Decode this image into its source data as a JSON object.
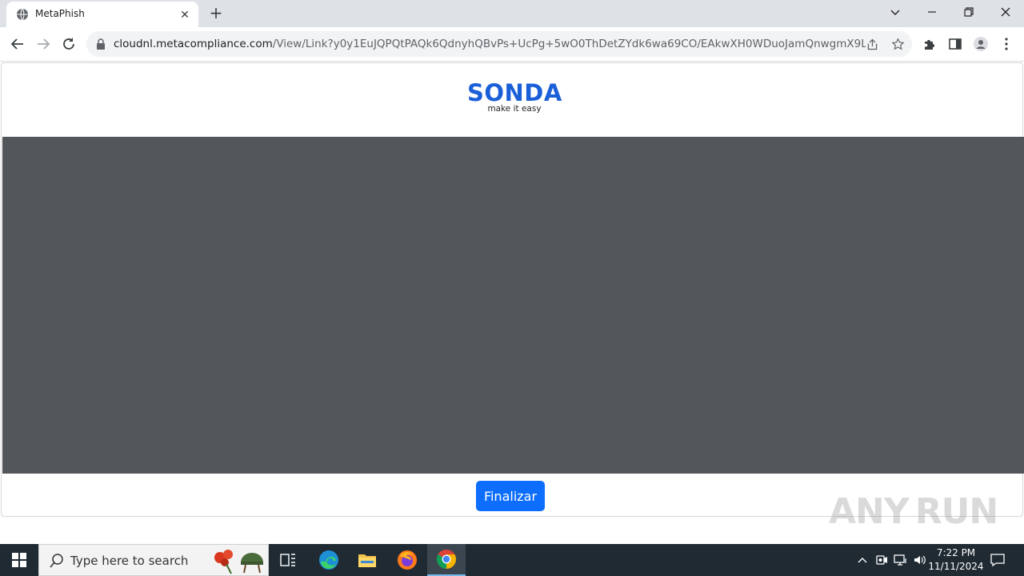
{
  "browser": {
    "tab": {
      "title": "MetaPhish"
    },
    "address": {
      "host": "cloudnl.metacompliance.com",
      "path": "/View/Link?y0y1EuJQPQtPAQk6QdnyhQBvPs+UcPg+5wO0ThDetZYdk6wa69CO/EAkwXH0WDuoJamQnwgmX9LS8wXcrr..."
    },
    "icons": {
      "favicon": "globe-icon",
      "back": "back-arrow-icon",
      "forward": "forward-arrow-icon",
      "reload": "reload-icon",
      "lock": "lock-icon",
      "share": "share-icon",
      "bookmark": "star-icon",
      "extensions": "puzzle-icon",
      "sidepanel": "side-panel-icon",
      "profile": "profile-icon",
      "menu": "kebab-menu-icon"
    }
  },
  "page": {
    "logo": {
      "name": "SONDA",
      "tagline": "make it easy"
    },
    "finish_button": "Finalizar",
    "watermark": "ANY RUN"
  },
  "taskbar": {
    "search_placeholder": "Type here to search",
    "apps": [
      "task-view-icon",
      "edge-icon",
      "file-explorer-icon",
      "firefox-icon",
      "chrome-icon"
    ],
    "clock": {
      "time": "7:22 PM",
      "date": "11/11/2024"
    }
  },
  "colors": {
    "accent": "#0d6efd",
    "logo": "#1a5fd8",
    "video_bg": "#53575b",
    "taskbar": "#1f2a33"
  }
}
